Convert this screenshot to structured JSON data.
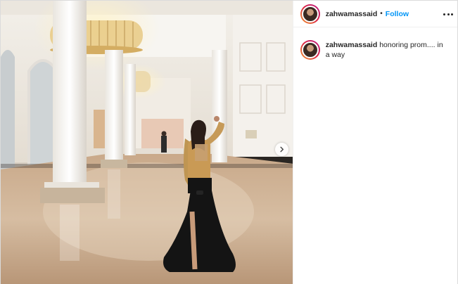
{
  "post": {
    "username": "zahwamassaid",
    "separator": "•",
    "follow_label": "Follow",
    "more_icon": "more-horizontal-icon",
    "caption_username": "zahwamassaid",
    "caption_text": "honoring prom.... in a way"
  },
  "media": {
    "next_icon": "chevron-right-icon"
  }
}
